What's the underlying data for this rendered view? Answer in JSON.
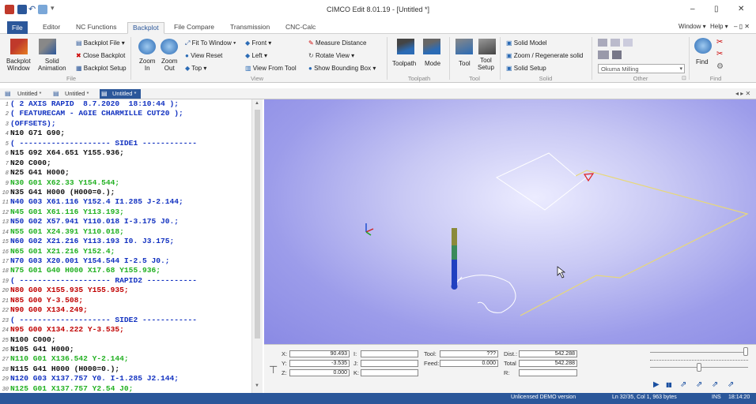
{
  "window": {
    "title": "CIMCO Edit 8.01.19 - [Untitled *]",
    "minimize": "–",
    "restore": "▯",
    "close": "✕"
  },
  "menu_right": {
    "window": "Window ▾",
    "help": "Help ▾",
    "extra": "– ▯ ✕"
  },
  "tabs": [
    "File",
    "Editor",
    "NC Functions",
    "Backplot",
    "File Compare",
    "Transmission",
    "CNC-Calc"
  ],
  "ribbon": {
    "file_group": {
      "backplot_window": "Backplot\nWindow",
      "solid_animation": "Solid\nAnimation",
      "backplot_file": "Backplot File ▾",
      "close_backplot": "Close Backplot",
      "backplot_setup": "Backplot Setup",
      "label": "File"
    },
    "view_group": {
      "zoom_in": "Zoom\nIn",
      "zoom_out": "Zoom\nOut",
      "fit_to_window": "Fit To Window ▾",
      "view_reset": "View Reset",
      "top": "Top ▾",
      "front": "Front ▾",
      "left": "Left ▾",
      "view_from_tool": "View From Tool",
      "measure_distance": "Measure Distance",
      "rotate_view": "Rotate View ▾",
      "show_bounding_box": "Show Bounding Box ▾",
      "label": "View"
    },
    "toolpath_group": {
      "toolpath": "Toolpath",
      "mode": "Mode",
      "label": "Toolpath"
    },
    "tool_group": {
      "tool": "Tool",
      "tool_setup": "Tool\nSetup",
      "label": "Tool"
    },
    "solid_group": {
      "solid_model": "Solid Model",
      "zoom_regenerate": "Zoom / Regenerate solid",
      "solid_setup": "Solid Setup",
      "label": "Solid"
    },
    "other_group": {
      "machine": "Okuma Milling",
      "label": "Other"
    },
    "find_group": {
      "find": "Find",
      "label": "Find"
    }
  },
  "doc_tabs": [
    "Untitled *",
    "Untitled *",
    "Untitled *"
  ],
  "doc_nav": "◂ ▸ ✕",
  "colors": {
    "red": "#c00000",
    "blue": "#1030c0",
    "green": "#20b020",
    "black": "#111111",
    "accent": "#2b579a"
  },
  "code_lines": [
    {
      "n": "1",
      "t": "( 2 AXIS RAPID  8.7.2020  18:10:44 );",
      "c": "blue"
    },
    {
      "n": "2",
      "t": "( FEATURECAM - AGIE CHARMILLE CUT20 );",
      "c": "blue"
    },
    {
      "n": "3",
      "t": "(OFFSETS);",
      "c": "blue"
    },
    {
      "n": "4",
      "t": "N10 G71 G90;",
      "c": "black"
    },
    {
      "n": "5",
      "t": "( -------------------- SIDE1 ------------",
      "c": "blue"
    },
    {
      "n": "6",
      "t": "N15 G92 X64.651 Y155.936;",
      "c": "black"
    },
    {
      "n": "7",
      "t": "N20 C000;",
      "c": "black"
    },
    {
      "n": "8",
      "t": "N25 G41 H000;",
      "c": "black"
    },
    {
      "n": "9",
      "t": "N30 G01 X62.33 Y154.544;",
      "c": "green"
    },
    {
      "n": "10",
      "t": "N35 G41 H000 (H000=0.);",
      "c": "black"
    },
    {
      "n": "11",
      "t": "N40 G03 X61.116 Y152.4 I1.285 J-2.144;",
      "c": "blue"
    },
    {
      "n": "12",
      "t": "N45 G01 X61.116 Y113.193;",
      "c": "green"
    },
    {
      "n": "13",
      "t": "N50 G02 X57.941 Y110.018 I-3.175 J0.;",
      "c": "blue"
    },
    {
      "n": "14",
      "t": "N55 G01 X24.391 Y110.018;",
      "c": "green"
    },
    {
      "n": "15",
      "t": "N60 G02 X21.216 Y113.193 I0. J3.175;",
      "c": "blue"
    },
    {
      "n": "16",
      "t": "N65 G01 X21.216 Y152.4;",
      "c": "green"
    },
    {
      "n": "17",
      "t": "N70 G03 X20.001 Y154.544 I-2.5 J0.;",
      "c": "blue"
    },
    {
      "n": "18",
      "t": "N75 G01 G40 H000 X17.68 Y155.936;",
      "c": "green"
    },
    {
      "n": "19",
      "t": "( -------------------- RAPID2 -----------",
      "c": "blue"
    },
    {
      "n": "20",
      "t": "N80 G00 X155.935 Y155.935;",
      "c": "red"
    },
    {
      "n": "21",
      "t": "N85 G00 Y-3.508;",
      "c": "red"
    },
    {
      "n": "22",
      "t": "N90 G00 X134.249;",
      "c": "red"
    },
    {
      "n": "23",
      "t": "( -------------------- SIDE2 ------------",
      "c": "blue"
    },
    {
      "n": "24",
      "t": "N95 G00 X134.222 Y-3.535;",
      "c": "red"
    },
    {
      "n": "25",
      "t": "N100 C000;",
      "c": "black"
    },
    {
      "n": "26",
      "t": "N105 G41 H000;",
      "c": "black"
    },
    {
      "n": "27",
      "t": "N110 G01 X136.542 Y-2.144;",
      "c": "green"
    },
    {
      "n": "28",
      "t": "N115 G41 H000 (H000=0.);",
      "c": "black"
    },
    {
      "n": "29",
      "t": "N120 G03 X137.757 Y0. I-1.285 J2.144;",
      "c": "blue"
    },
    {
      "n": "30",
      "t": "N125 G01 X137.757 Y2.54 J0;",
      "c": "green"
    }
  ],
  "info": {
    "x_label": "X:",
    "x_val": "90.493",
    "y_label": "Y:",
    "y_val": "-3.535",
    "z_label": "Z:",
    "z_val": "0.000",
    "i_label": "I:",
    "j_label": "J:",
    "k_label": "K:",
    "tool_label": "Tool:",
    "tool_val": "???",
    "feed_label": "Feed:",
    "feed_val": "0.000",
    "dist_label": "Dist.:",
    "dist_val": "542.288",
    "total_label": "Total",
    "total_val": "542.288",
    "r_label": "R:"
  },
  "playback": {
    "play": "▶",
    "pause": "▮▮",
    "progress_pct": 100,
    "speed_pct": 50
  },
  "status": {
    "demo": "Unlicensed DEMO version",
    "position": "Ln 32/35, Col 1, 963 bytes",
    "mode": "INS",
    "time": "18:14:20"
  }
}
